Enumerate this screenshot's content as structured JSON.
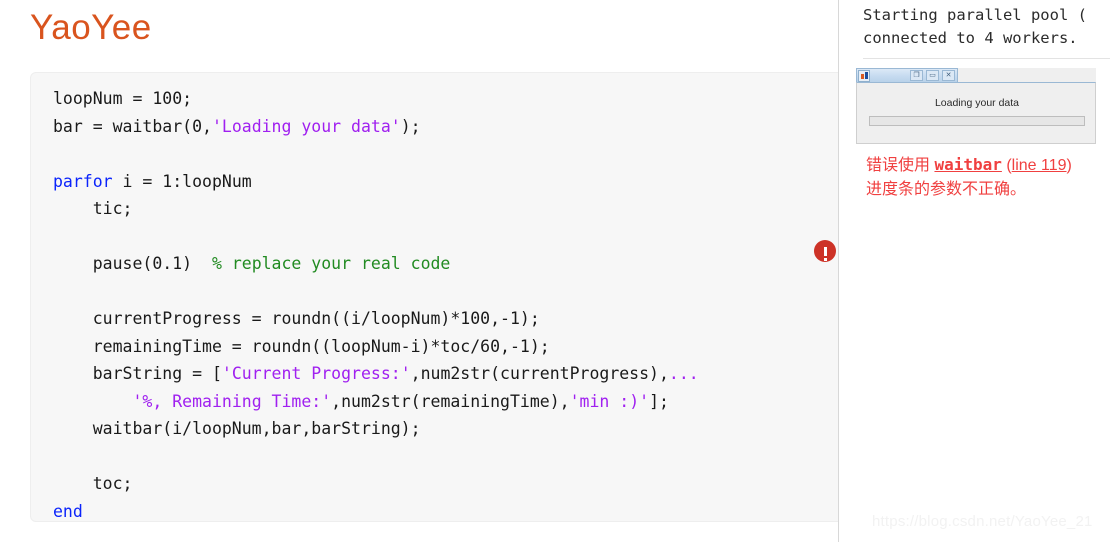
{
  "page": {
    "title": "YaoYee",
    "title_color": "#d9541e",
    "watermark": "https://blog.csdn.net/YaoYee_21"
  },
  "code_block": {
    "language": "matlab",
    "colors": {
      "keyword": "#0b24fb",
      "string": "#a020f0",
      "comment": "#228b22",
      "text": "#1a1a1a",
      "background": "#f7f7f7"
    },
    "lines": [
      "loopNum = 100;",
      "bar = waitbar(0,'Loading your data');",
      "",
      "parfor i = 1:loopNum",
      "    tic;",
      "",
      "    pause(0.1)  % replace your real code",
      "",
      "    currentProgress = roundn((i/loopNum)*100,-1);",
      "    remainingTime = roundn((loopNum-i)*toc/60,-1);",
      "    barString = ['Current Progress:',num2str(currentProgress),...",
      "        '%, Remaining Time:',num2str(remainingTime),'min :)'];",
      "    waitbar(i/loopNum,bar,barString);",
      "",
      "    toc;",
      "end"
    ],
    "tokens": {
      "kw_parfor": "parfor",
      "kw_end": "end",
      "str_loading": "'Loading your data'",
      "comment_replace": "% replace your real code",
      "str_current_progress": "'Current Progress:'",
      "str_remaining": "'%, Remaining Time:'",
      "str_min": "'min :)'",
      "continuation": "..."
    },
    "error_marker": {
      "icon": "error-circle-icon",
      "color": "#cd3227",
      "symbol": "!"
    }
  },
  "console": {
    "output_line1": "Starting parallel pool (",
    "output_line2": "connected to 4 workers."
  },
  "waitbar_dialog": {
    "icon": "matlab-membrane-icon",
    "buttons": {
      "restore": "restore-window-icon",
      "minimize": "minimize-window-icon",
      "close": "close-window-icon",
      "restore_glyph": "❐",
      "minimize_glyph": "▭",
      "close_glyph": "✕"
    },
    "label": "Loading your data",
    "progress_percent": 0
  },
  "error_message": {
    "prefix": "错误使用 ",
    "function": "waitbar",
    "location_open": " (",
    "location": "line 119",
    "location_close": ")",
    "detail": "进度条的参数不正确。",
    "color": "#f04040"
  }
}
